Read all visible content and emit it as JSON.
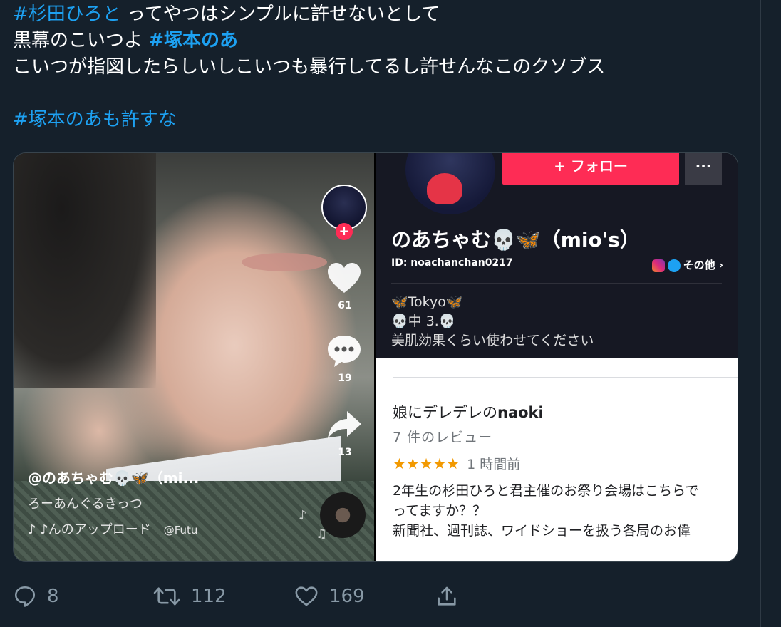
{
  "tweet": {
    "hashtag1": "#杉田ひろと",
    "line1_rest": " ってやつはシンプルに許せないとして",
    "line2_text": "黒幕のこいつよ ",
    "hashtag2": "#塚本のあ",
    "line3": "こいつが指図したらしいしこいつも暴行してるし許せんなこのクソブス",
    "hashtag3": "#塚本のあ",
    "line4_rest": "も許すな"
  },
  "left_video": {
    "like_count": "61",
    "comment_count": "19",
    "share_count": "13",
    "username": "@のあちゃむ💀🦋（mi...",
    "description": "ろーあんぐるきっつ",
    "sound_text": "♪ ♪んのアップロード",
    "sound_handle": "@Futu"
  },
  "profile": {
    "follow_label": "+ フォロー",
    "more_label": "···",
    "name": "のあちゃむ💀🦋（mio's）",
    "id_text": "ID: noachanchan0217",
    "other_label": "その他 ›",
    "bio_line1": "🦋Tokyo🦋",
    "bio_line2": "💀中 3.💀",
    "bio_line3": "美肌効果くらい使わせてください"
  },
  "review": {
    "reviewer_prefix": "娘にデレデレの",
    "reviewer_bold": "naoki",
    "review_count": "7 件のレビュー",
    "stars": "★★★★★",
    "time_ago": "1 時間前",
    "body_line1": "2年生の杉田ひろと君主催のお祭り会場はこちらで",
    "body_line2": "ってますか？？",
    "body_line3": "新聞社、週刊誌、ワイドショーを扱う各局のお偉"
  },
  "actions": {
    "reply_count": "8",
    "retweet_count": "112",
    "like_count": "169"
  },
  "colors": {
    "background": "#15202b",
    "hashtag": "#1da1f2",
    "tiktok_red": "#fe2c55",
    "icon_gray": "#8899a6"
  }
}
